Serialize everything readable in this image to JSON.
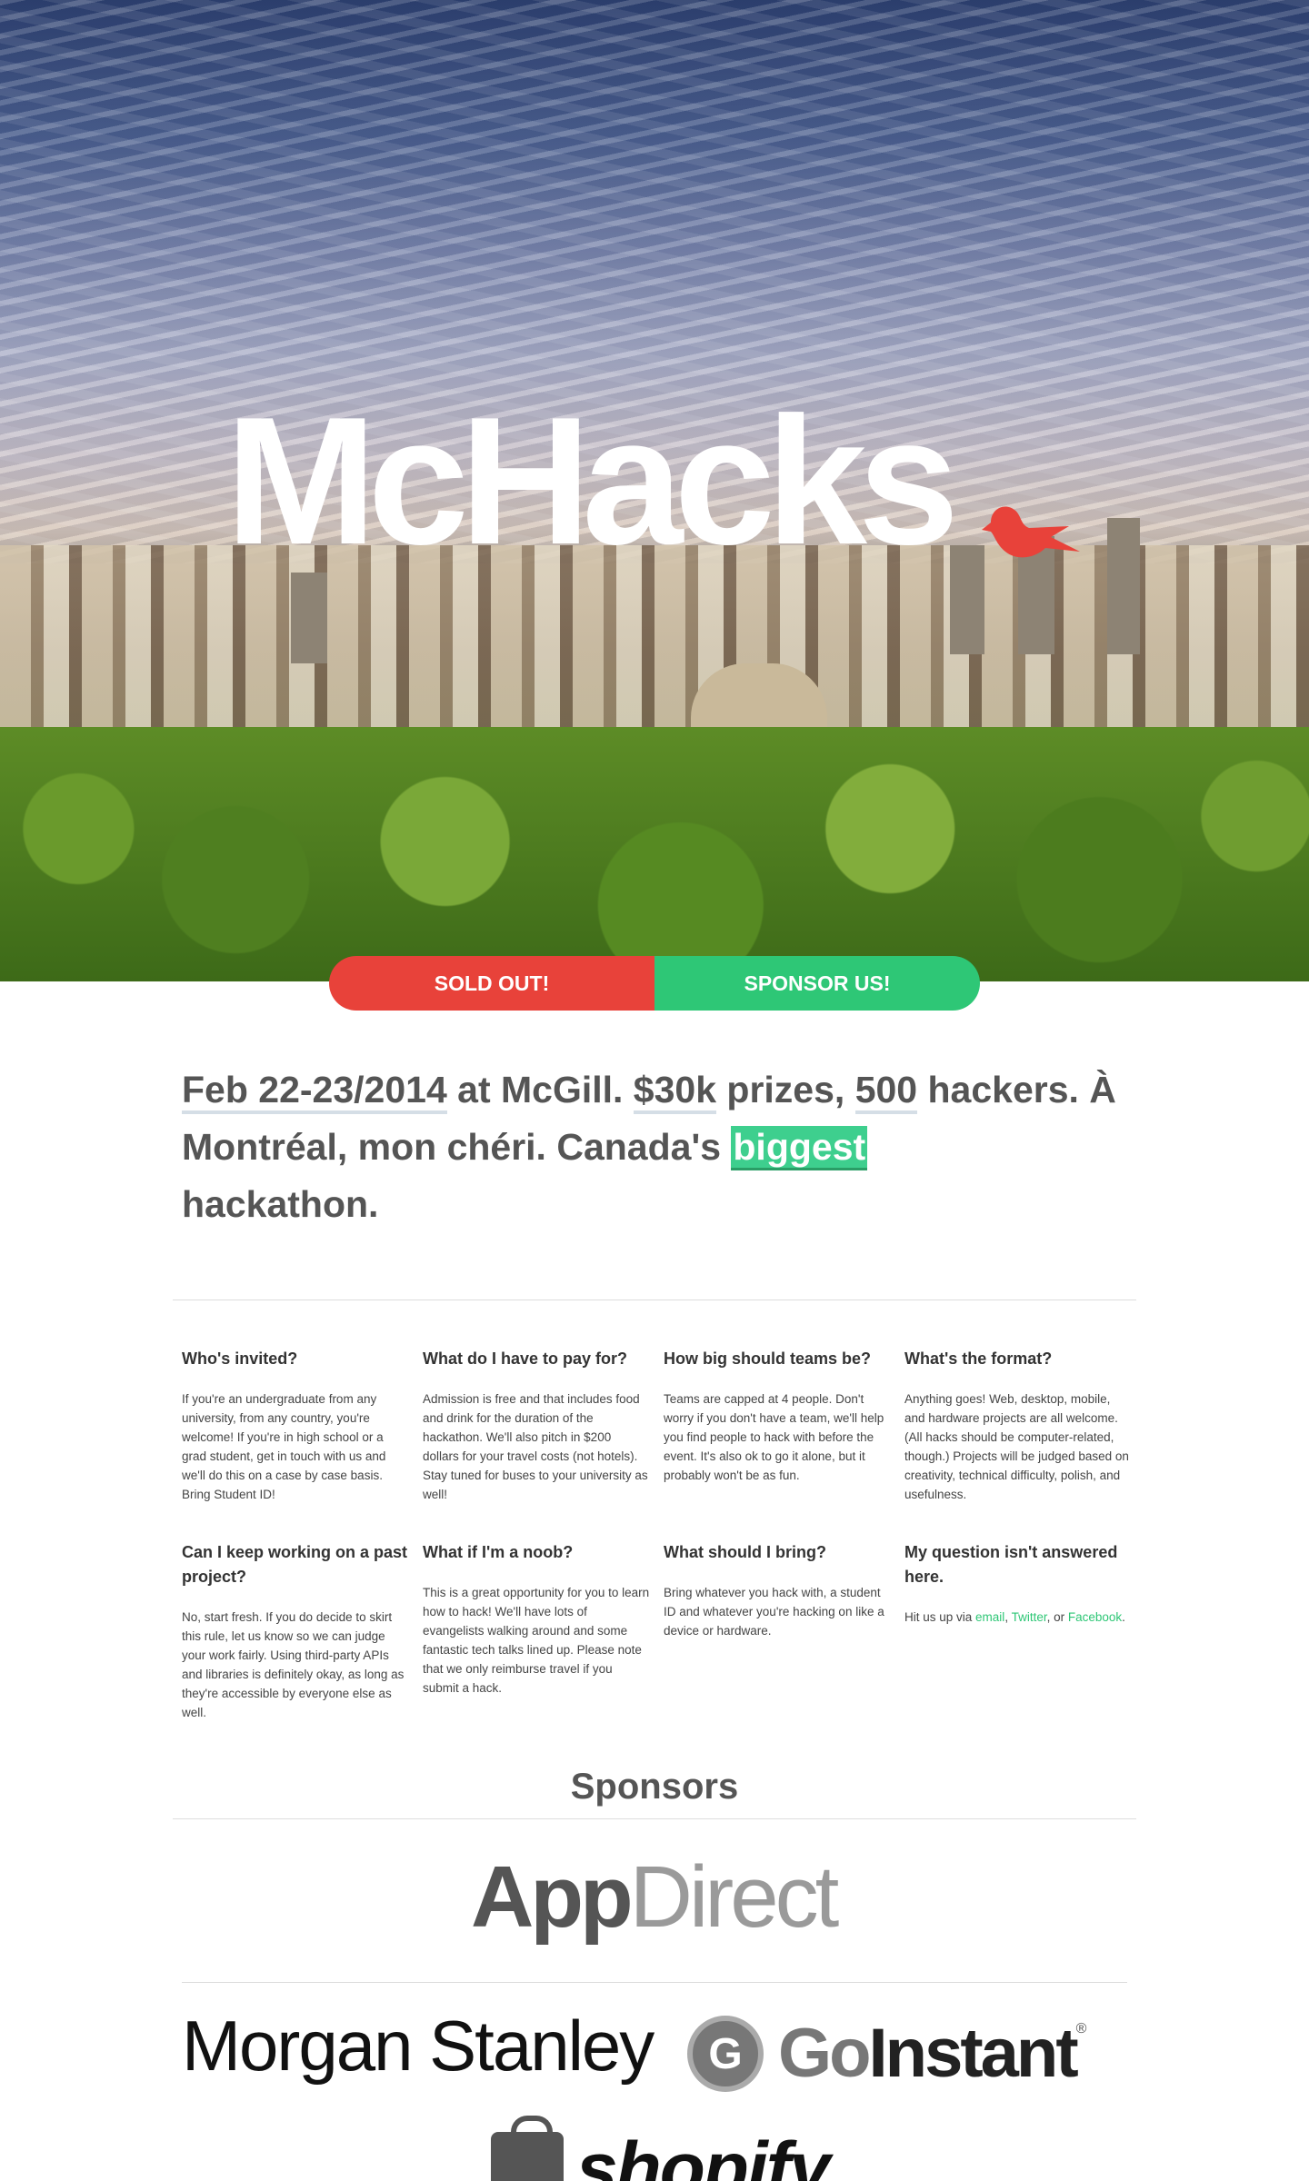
{
  "hero": {
    "logo_text": "McHacks",
    "bird_icon": "red-bird-icon",
    "accent_color": "#e8423a"
  },
  "cta": {
    "sold_out_label": "SOLD OUT!",
    "sponsor_label": "SPONSOR US!",
    "red": "#e8423a",
    "green": "#2ec776"
  },
  "headline": {
    "date": "Feb 22-23/2014",
    "at": " at McGill. ",
    "prizes_amount": "$30k",
    "prizes_suffix": " prizes, ",
    "hackers_count": "500",
    "hackers_suffix": " hackers. À Montréal, mon chéri. Canada's ",
    "highlight": "biggest",
    "end": " hackathon."
  },
  "faq": [
    {
      "q": "Who's invited?",
      "a": "If you're an undergraduate from any university, from any country, you're welcome! If you're in high school or a grad student, get in touch with us and we'll do this on a case by case basis. Bring Student ID!"
    },
    {
      "q": "What do I have to pay for?",
      "a": "Admission is free and that includes food and drink for the duration of the hackathon. We'll also pitch in $200 dollars for your travel costs (not hotels). Stay tuned for buses to your university as well!"
    },
    {
      "q": "How big should teams be?",
      "a": "Teams are capped at 4 people. Don't worry if you don't have a team, we'll help you find people to hack with before the event. It's also ok to go it alone, but it probably won't be as fun."
    },
    {
      "q": "What's the format?",
      "a": "Anything goes! Web, desktop, mobile, and hardware projects are all welcome. (All hacks should be computer-related, though.) Projects will be judged based on creativity, technical difficulty, polish, and usefulness."
    },
    {
      "q": "Can I keep working on a past project?",
      "a": "No, start fresh. If you do decide to skirt this rule, let us know so we can judge your work fairly. Using third-party APIs and libraries is definitely okay, as long as they're accessible by everyone else as well."
    },
    {
      "q": "What if I'm a noob?",
      "a": "This is a great opportunity for you to learn how to hack! We'll have lots of evangelists walking around and some fantastic tech talks lined up. Please note that we only reimburse travel if you submit a hack."
    },
    {
      "q": "What should I bring?",
      "a": "Bring whatever you hack with, a student ID and whatever you're hacking on like a device or hardware."
    },
    {
      "q": "My question isn't answered here.",
      "a_prefix": "Hit us up via ",
      "link_email": "email",
      "sep1": ", ",
      "link_twitter": "Twitter",
      "sep2": ", or ",
      "link_facebook": "Facebook",
      "a_suffix": "."
    }
  ],
  "sponsors": {
    "title": "Sponsors",
    "appdirect_part1": "App",
    "appdirect_part2": "Direct",
    "morgan": "Morgan Stanley",
    "goinstant_badge": "G",
    "goinstant_part1": "Go",
    "goinstant_part2": "Instant",
    "goinstant_reg": "®",
    "shopify": "shopify"
  }
}
